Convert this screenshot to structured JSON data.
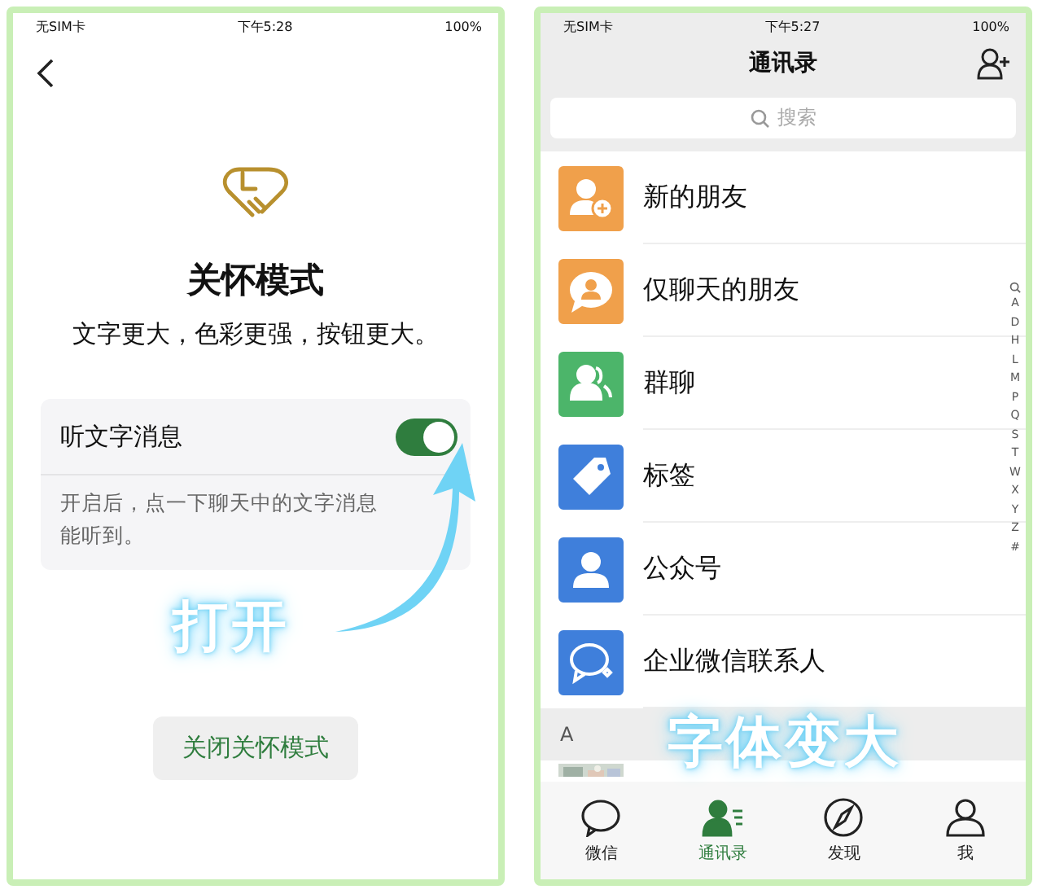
{
  "left_screen": {
    "status_bar": {
      "carrier": "无SIM卡",
      "time": "下午5:28",
      "battery": "100%"
    },
    "title": "关怀模式",
    "subtitle": "文字更大，色彩更强，按钮更大。",
    "setting": {
      "label": "听文字消息",
      "on": true,
      "description": [
        "开启后，点一下聊天中的文字消息",
        "能听到。"
      ]
    },
    "button": "关闭关怀模式",
    "annotation": "打开"
  },
  "right_screen": {
    "status_bar": {
      "carrier": "无SIM卡",
      "time": "下午5:27",
      "battery": "100%"
    },
    "title": "通讯录",
    "search": {
      "placeholder": "搜索"
    },
    "items": [
      {
        "label": "新的朋友",
        "kind": "add-person",
        "color": "#f0a04b"
      },
      {
        "label": "仅聊天的朋友",
        "kind": "chat-person",
        "color": "#f0a04b"
      },
      {
        "label": "群聊",
        "kind": "group",
        "color": "#4cb56a"
      },
      {
        "label": "标签",
        "kind": "tag",
        "color": "#3f7fdb"
      },
      {
        "label": "公众号",
        "kind": "person",
        "color": "#3f7fdb"
      },
      {
        "label": "企业微信联系人",
        "kind": "work-chat",
        "color": "#3f7fdb"
      }
    ],
    "index": [
      "A",
      "D",
      "H",
      "L",
      "M",
      "P",
      "Q",
      "S",
      "T",
      "W",
      "X",
      "Y",
      "Z",
      "#"
    ],
    "section_header": "A",
    "annotation": "字体变大",
    "tabs": [
      {
        "label": "微信",
        "kind": "chat",
        "selected": false
      },
      {
        "label": "通讯录",
        "kind": "contacts",
        "selected": true
      },
      {
        "label": "发现",
        "kind": "compass",
        "selected": false
      },
      {
        "label": "我",
        "kind": "me",
        "selected": false
      }
    ]
  }
}
